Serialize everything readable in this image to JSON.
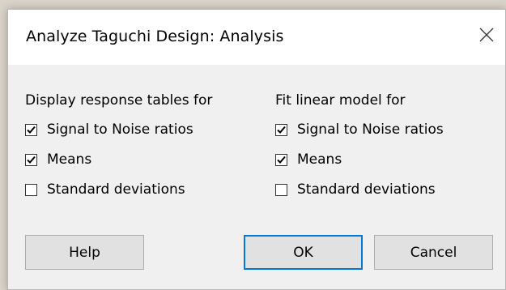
{
  "window": {
    "title": "Analyze Taguchi Design: Analysis"
  },
  "display_group": {
    "heading": "Display response tables for",
    "options": [
      {
        "label": "Signal to Noise ratios",
        "checked": true
      },
      {
        "label": "Means",
        "checked": true
      },
      {
        "label": "Standard deviations",
        "checked": false
      }
    ]
  },
  "fit_group": {
    "heading": "Fit linear model for",
    "options": [
      {
        "label": "Signal to Noise ratios",
        "checked": true
      },
      {
        "label": "Means",
        "checked": true
      },
      {
        "label": "Standard deviations",
        "checked": false
      }
    ]
  },
  "buttons": {
    "help": "Help",
    "ok": "OK",
    "cancel": "Cancel"
  },
  "colors": {
    "accent": "#0078d7",
    "dialog_bg": "#f0f0f0",
    "titlebar_bg": "#ffffff"
  }
}
